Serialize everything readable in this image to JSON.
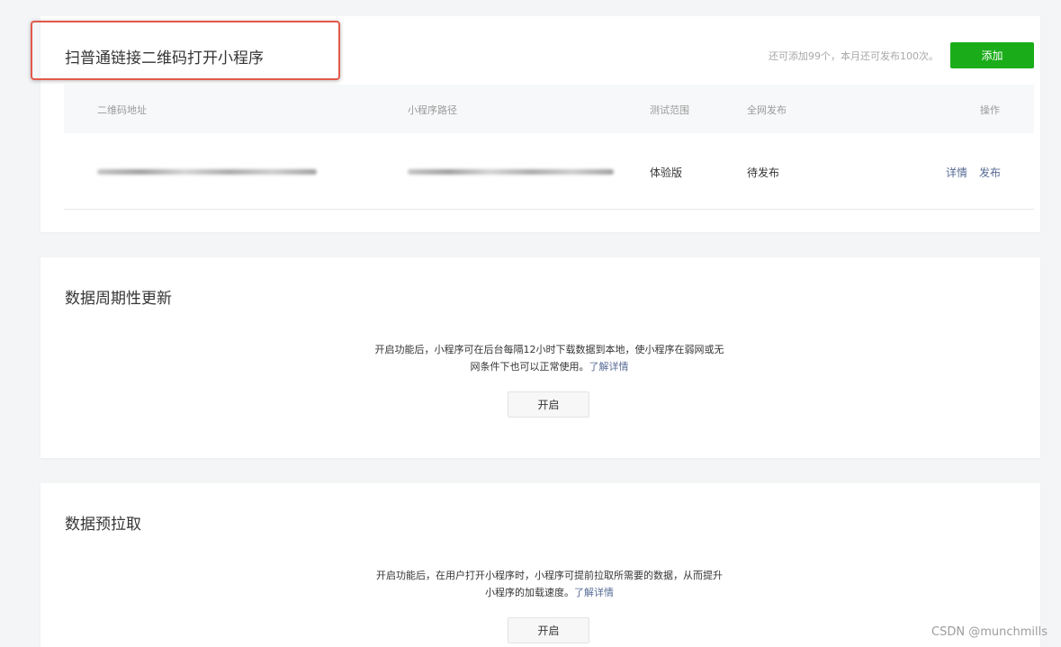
{
  "qrcode_section": {
    "title": "扫普通链接二维码打开小程序",
    "quota_text": "还可添加99个，本月还可发布100次。",
    "add_button": "添加",
    "table": {
      "headers": [
        "二维码地址",
        "小程序路径",
        "测试范围",
        "全网发布",
        "操作"
      ],
      "rows": [
        {
          "qr_address": "",
          "mp_path": "",
          "test_scope": "体验版",
          "publish_status": "待发布",
          "actions": [
            "详情",
            "发布"
          ]
        }
      ]
    }
  },
  "periodic_update_section": {
    "title": "数据周期性更新",
    "description_line1": "开启功能后，小程序可在后台每隔12小时下载数据到本地，使小程序在弱网或无",
    "description_line2": "网条件下也可以正常使用。",
    "learn_more": "了解详情",
    "enable_button": "开启"
  },
  "prefetch_section": {
    "title": "数据预拉取",
    "description_line1": "开启功能后，在用户打开小程序时，小程序可提前拉取所需要的数据，从而提升",
    "description_line2": "小程序的加载速度。",
    "learn_more": "了解详情",
    "enable_button": "开启"
  },
  "watermark": "CSDN @munchmills",
  "colors": {
    "primary_green": "#1aad19",
    "link_blue": "#576b95",
    "highlight_red": "#e25a4a",
    "page_background": "#f3f5f7"
  }
}
